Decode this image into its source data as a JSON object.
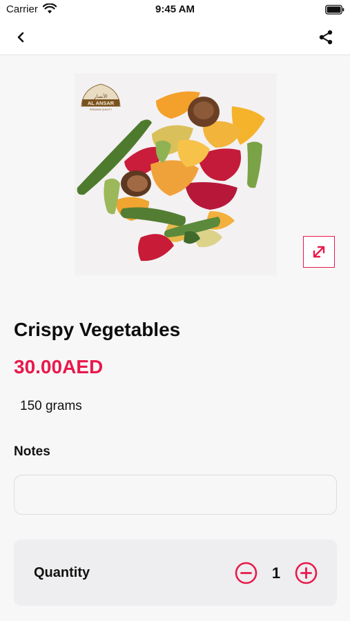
{
  "status_bar": {
    "carrier": "Carrier",
    "time": "9:45 AM"
  },
  "nav": {
    "back_icon": "chevron-left-icon",
    "share_icon": "share-icon"
  },
  "product": {
    "image_icon": "product-photo",
    "logo_name": "AL ANSAR",
    "logo_arabic": "الأنصار",
    "logo_tagline": "PREMIUM QUALITY",
    "expand_icon": "expand-icon",
    "title": "Crispy Vegetables",
    "price": "30.00AED",
    "weight": "150 grams"
  },
  "notes": {
    "label": "Notes",
    "value": "",
    "placeholder": ""
  },
  "quantity": {
    "label": "Quantity",
    "value": "1",
    "minus_icon": "minus-circle-icon",
    "plus_icon": "plus-circle-icon"
  },
  "colors": {
    "accent": "#e8194b",
    "background": "#f7f7f8",
    "card": "#eeeef0"
  }
}
